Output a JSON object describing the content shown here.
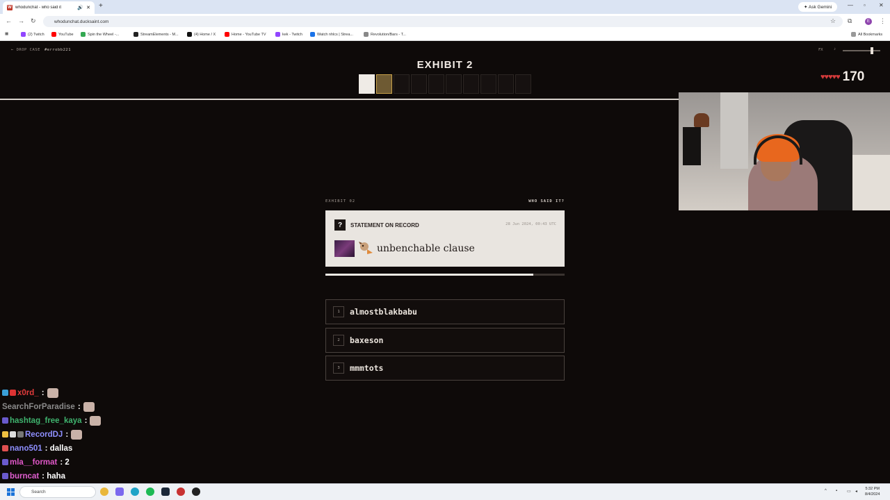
{
  "browser": {
    "tab_title": "whodunchat - who said it",
    "new_tab": "+",
    "gemini": "✦ Ask Gemini",
    "url": "whodunchat.ducksaint.com",
    "bookmarks": [
      {
        "label": "(2) Twitch",
        "color": "#9146ff"
      },
      {
        "label": "YouTube",
        "color": "#ff0000"
      },
      {
        "label": "Spin the Wheel -...",
        "color": "#33a852"
      },
      {
        "label": "StreamElements - M...",
        "color": "#222222"
      },
      {
        "label": "(4) Home / X",
        "color": "#111111"
      },
      {
        "label": "Home - YouTube TV",
        "color": "#ff0000"
      },
      {
        "label": "kek - Twitch",
        "color": "#9146ff"
      },
      {
        "label": "Watch nhlcs | Strea...",
        "color": "#1a73e8"
      },
      {
        "label": "Revolution/Bars - T...",
        "color": "#888888"
      }
    ],
    "all_bookmarks": "All Bookmarks"
  },
  "game": {
    "drop_case": "← DROP CASE",
    "handle": "#errobb221",
    "fx": "FX",
    "note": "♪",
    "volume": 0.8,
    "title": "EXHIBIT 2",
    "slots": [
      "done",
      "current",
      "empty",
      "empty",
      "empty",
      "empty",
      "empty",
      "empty",
      "empty",
      "empty"
    ],
    "hearts": "♥♥♥♥♥",
    "score": "170",
    "exhibit_label": "EXHIBIT 02",
    "who_said": "WHO SAID IT?",
    "card": {
      "qmark": "?",
      "heading": "STATEMENT ON RECORD",
      "timestamp": "28 Jun 2024, 00:43 UTC",
      "message": "unbenchable clause"
    },
    "timer_fraction": 0.87,
    "options": [
      {
        "num": "1",
        "name": "almostblakbabu"
      },
      {
        "num": "2",
        "name": "baxeson"
      },
      {
        "num": "3",
        "name": "mmmtots"
      }
    ]
  },
  "chat": [
    {
      "user": "x0rd_",
      "color": "#e23b3b",
      "text": ":",
      "emote": true
    },
    {
      "user": "SearchForParadise",
      "color": "#8a8a8a",
      "text": ":",
      "emote": true
    },
    {
      "user": "hashtag_free_kaya",
      "color": "#3fb36e",
      "text": ":",
      "emote": true
    },
    {
      "user": "RecordDJ",
      "color": "#8f8fff",
      "text": ":",
      "emote": true
    },
    {
      "user": "nano501",
      "color": "#8f8fff",
      "text": ": dallas",
      "emote": false
    },
    {
      "user": "mla__format",
      "color": "#e057c8",
      "text": ": 2",
      "emote": true
    },
    {
      "user": "burncat",
      "color": "#e05fd0",
      "text": ": haha",
      "emote": false
    }
  ],
  "taskbar": {
    "search": "Search",
    "time": "5:32 PM",
    "date": "8/4/2024"
  }
}
